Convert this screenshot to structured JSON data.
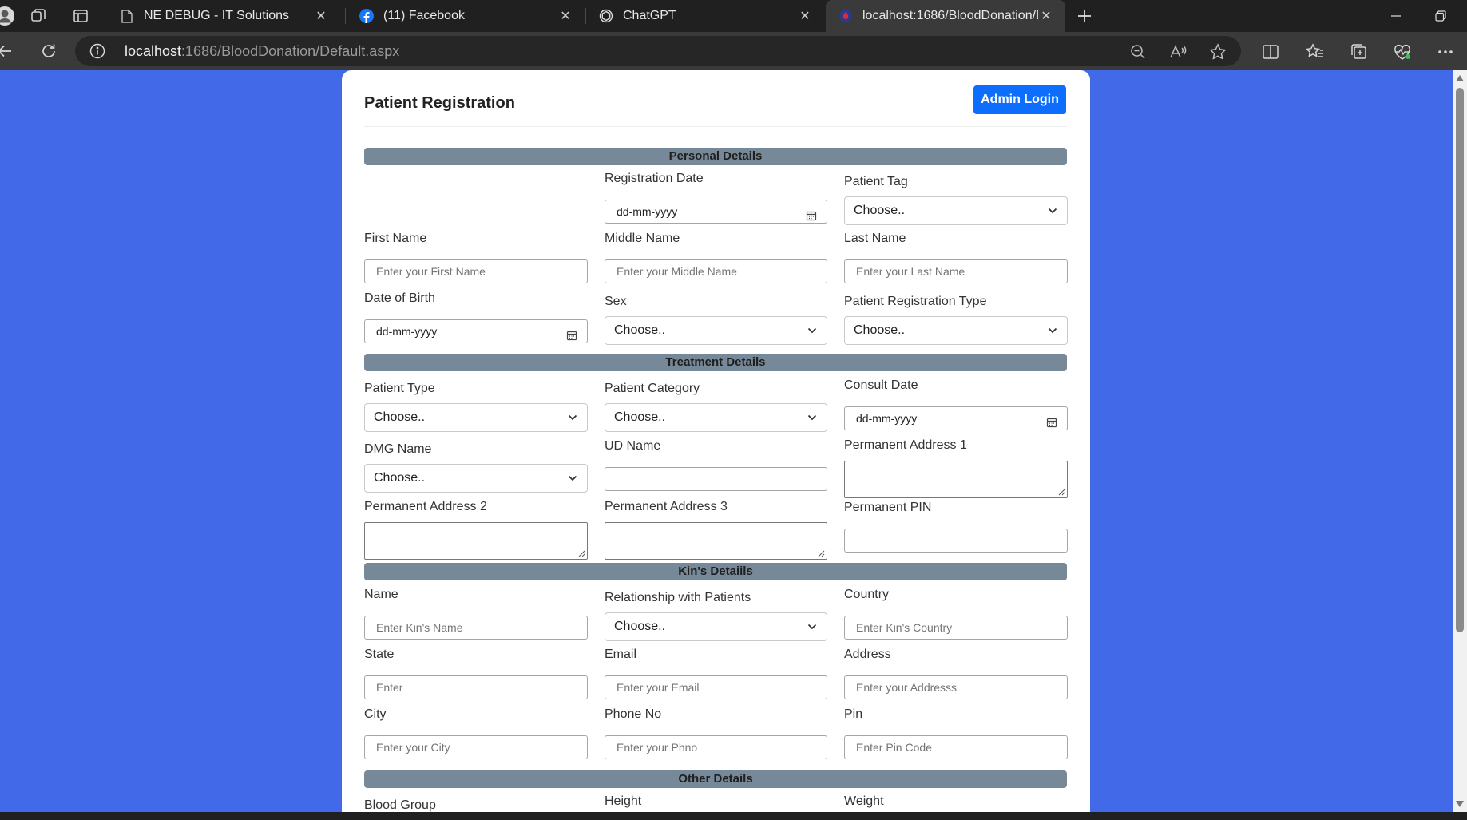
{
  "browser": {
    "tabs": [
      {
        "title": "NE DEBUG - IT Solutions",
        "favicon": "page-icon",
        "active": false
      },
      {
        "title": "(11) Facebook",
        "favicon": "facebook-icon",
        "active": false
      },
      {
        "title": "ChatGPT",
        "favicon": "chatgpt-icon",
        "active": false
      },
      {
        "title": "localhost:1686/BloodDonation/D",
        "favicon": "blood-donation-icon",
        "active": true
      }
    ],
    "url_host": "localhost",
    "url_path": ":1686/BloodDonation/Default.aspx"
  },
  "colors": {
    "page_background": "#4169e8",
    "section_bar": "#778899",
    "primary_button": "#0d6efd"
  },
  "page": {
    "title": "Patient Registration",
    "admin_login": "Admin Login"
  },
  "sections": {
    "personal": "Personal Details",
    "treatment": "Treatment Details",
    "kin": "Kin's Detaiils",
    "other": "Other Details"
  },
  "personal": {
    "registration_date": {
      "label": "Registration Date",
      "value": "dd-mm-yyyy"
    },
    "patient_tag": {
      "label": "Patient Tag",
      "value": "Choose.."
    },
    "first_name": {
      "label": "First Name",
      "placeholder": "Enter your First Name"
    },
    "middle_name": {
      "label": "Middle Name",
      "placeholder": "Enter your Middle Name"
    },
    "last_name": {
      "label": "Last Name",
      "placeholder": "Enter your Last Name"
    },
    "dob": {
      "label": "Date of Birth",
      "value": "dd-mm-yyyy"
    },
    "sex": {
      "label": "Sex",
      "value": "Choose.."
    },
    "registration_type": {
      "label": "Patient Registration Type",
      "value": "Choose.."
    }
  },
  "treatment": {
    "patient_type": {
      "label": "Patient Type",
      "value": "Choose.."
    },
    "patient_category": {
      "label": "Patient Category",
      "value": "Choose.."
    },
    "consult_date": {
      "label": "Consult Date",
      "value": "dd-mm-yyyy"
    },
    "dmg_name": {
      "label": "DMG Name",
      "value": "Choose.."
    },
    "ud_name": {
      "label": "UD Name",
      "value": ""
    },
    "perm_address_1": {
      "label": "Permanent Address 1"
    },
    "perm_address_2": {
      "label": "Permanent Address 2"
    },
    "perm_address_3": {
      "label": "Permanent Address 3"
    },
    "perm_pin": {
      "label": "Permanent PIN",
      "value": ""
    }
  },
  "kin": {
    "name": {
      "label": "Name",
      "placeholder": "Enter Kin's Name"
    },
    "relationship": {
      "label": "Relationship with Patients",
      "value": "Choose.."
    },
    "country": {
      "label": "Country",
      "placeholder": "Enter Kin's Country"
    },
    "state": {
      "label": "State",
      "placeholder": "Enter"
    },
    "email": {
      "label": "Email",
      "placeholder": "Enter your Email"
    },
    "address": {
      "label": "Address",
      "placeholder": "Enter your Addresss"
    },
    "city": {
      "label": "City",
      "placeholder": "Enter your City"
    },
    "phone": {
      "label": "Phone No",
      "placeholder": "Enter your Phno"
    },
    "pin": {
      "label": "Pin",
      "placeholder": "Enter Pin Code"
    }
  },
  "other": {
    "blood_group": {
      "label": "Blood Group"
    },
    "height": {
      "label": "Height"
    },
    "weight": {
      "label": "Weight"
    }
  }
}
